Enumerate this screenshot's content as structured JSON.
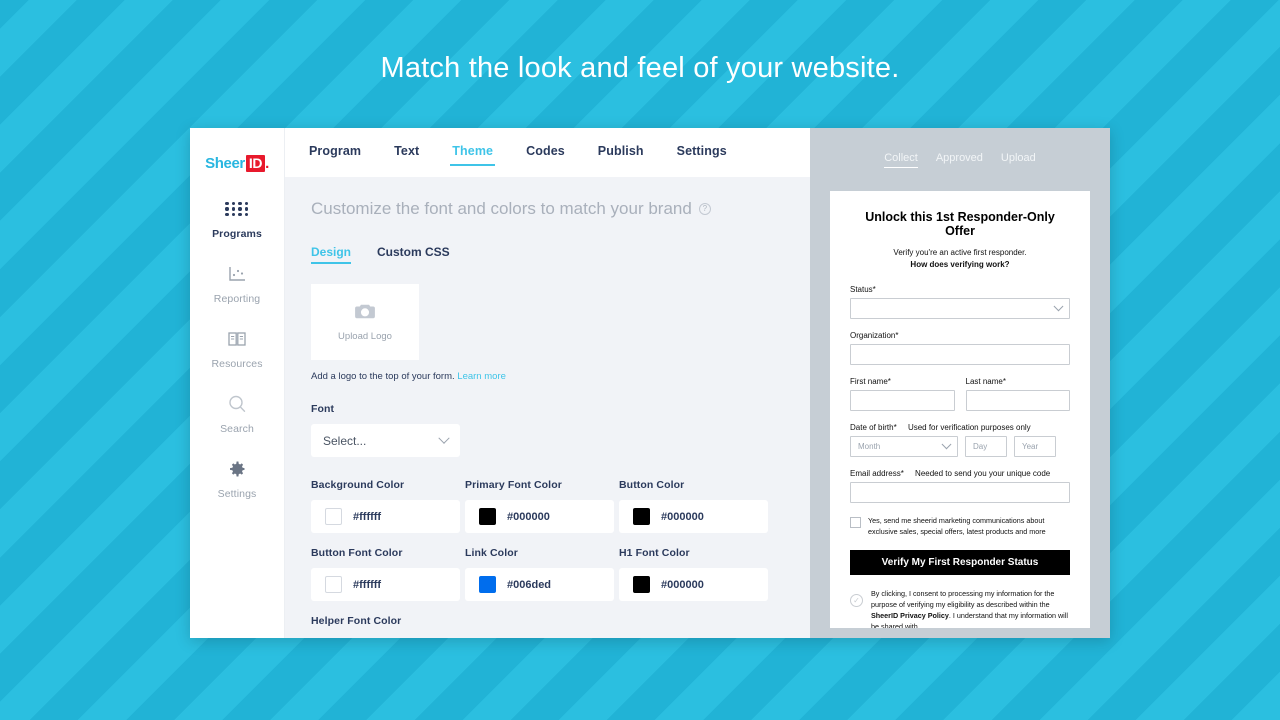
{
  "hero": {
    "title": "Match the look and feel of your website."
  },
  "brand": {
    "name_part1": "Sheer",
    "name_part2": "ID",
    "dot": "."
  },
  "sidebar": {
    "items": [
      {
        "label": "Programs",
        "icon": "grid-icon",
        "active": true
      },
      {
        "label": "Reporting",
        "icon": "chart-icon",
        "active": false
      },
      {
        "label": "Resources",
        "icon": "book-icon",
        "active": false
      },
      {
        "label": "Search",
        "icon": "search-icon",
        "active": false
      },
      {
        "label": "Settings",
        "icon": "gear-icon",
        "active": false
      }
    ]
  },
  "topnav": {
    "tabs": [
      {
        "label": "Program",
        "active": false
      },
      {
        "label": "Text",
        "active": false
      },
      {
        "label": "Theme",
        "active": true
      },
      {
        "label": "Codes",
        "active": false
      },
      {
        "label": "Publish",
        "active": false
      },
      {
        "label": "Settings",
        "active": false
      }
    ]
  },
  "editor": {
    "subhead": "Customize the font and colors to match your brand",
    "help_glyph": "?",
    "subtabs": [
      {
        "label": "Design",
        "active": true
      },
      {
        "label": "Custom CSS",
        "active": false
      }
    ],
    "upload": {
      "label": "Upload Logo",
      "icon": "camera-icon",
      "hint_text": "Add a logo to the top of your form.",
      "hint_link": "Learn more"
    },
    "font": {
      "label": "Font",
      "value": "Select...",
      "icon": "chevron-down-icon"
    },
    "colors": [
      {
        "label": "Background Color",
        "value": "#ffffff",
        "swatch": "#ffffff"
      },
      {
        "label": "Primary Font Color",
        "value": "#000000",
        "swatch": "#000000"
      },
      {
        "label": "Button Color",
        "value": "#000000",
        "swatch": "#000000"
      },
      {
        "label": "Button Font Color",
        "value": "#ffffff",
        "swatch": "#ffffff"
      },
      {
        "label": "Link Color",
        "value": "#006ded",
        "swatch": "#006ded"
      },
      {
        "label": "H1 Font Color",
        "value": "#000000",
        "swatch": "#000000"
      }
    ],
    "helper_color_label": "Helper Font Color"
  },
  "preview": {
    "tabs": [
      {
        "label": "Collect",
        "active": true
      },
      {
        "label": "Approved",
        "active": false
      },
      {
        "label": "Upload",
        "active": false
      }
    ],
    "form": {
      "title": "Unlock this 1st Responder-Only Offer",
      "sub_line1": "Verify you're an active first responder.",
      "sub_line2": "How does verifying work?",
      "status_label": "Status*",
      "status_value": "",
      "organization_label": "Organization*",
      "organization_value": "",
      "first_name_label": "First name*",
      "first_name_value": "",
      "last_name_label": "Last name*",
      "last_name_value": "",
      "dob_label": "Date of birth*",
      "dob_hint": "Used for verification purposes only",
      "dob_month": "Month",
      "dob_day": "Day",
      "dob_year": "Year",
      "email_label": "Email address*",
      "email_hint": "Needed to send you your unique code",
      "email_value": "",
      "consent_text": "Yes, send me sheerid marketing communications about exclusive sales, special offers, latest products and more",
      "submit_label": "Verify My First Responder Status",
      "legal_pre": "By clicking, I consent to processing my information for the purpose of verifying my eligibility as described within the ",
      "legal_link": "SheerID Privacy Policy",
      "legal_post": ". I understand that my information will be shared with"
    }
  }
}
